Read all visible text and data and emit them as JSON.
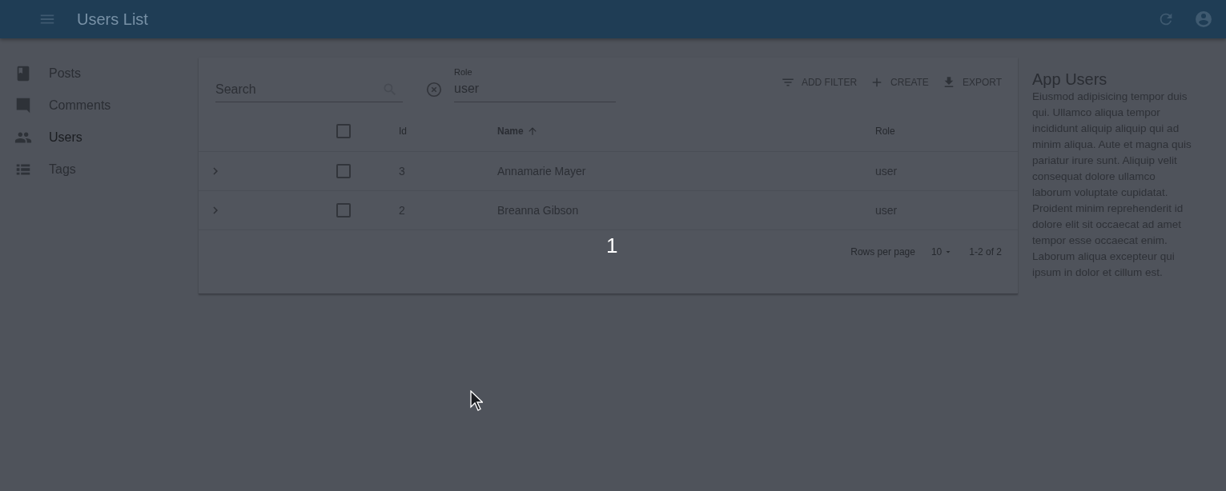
{
  "app_bar": {
    "title": "Users List"
  },
  "sidebar": {
    "items": [
      {
        "label": "Posts",
        "kind": "book",
        "selected": false
      },
      {
        "label": "Comments",
        "kind": "comment",
        "selected": false
      },
      {
        "label": "Users",
        "kind": "people",
        "selected": true
      },
      {
        "label": "Tags",
        "kind": "list",
        "selected": false
      }
    ]
  },
  "filters": {
    "search": {
      "placeholder": "Search"
    },
    "role": {
      "label": "Role",
      "value": "user"
    }
  },
  "actions": [
    {
      "label": "ADD FILTER",
      "kind": "filter"
    },
    {
      "label": "CREATE",
      "kind": "plus"
    },
    {
      "label": "EXPORT",
      "kind": "download"
    }
  ],
  "table": {
    "select_all": {
      "checked": false
    },
    "columns": [
      {
        "label": "Id",
        "sorted": false
      },
      {
        "label": "Name",
        "sorted": true
      },
      {
        "label": "Role",
        "sorted": false
      }
    ],
    "rows": [
      {
        "checked": false,
        "cells": [
          "3",
          "Annamarie Mayer",
          "user"
        ]
      },
      {
        "checked": false,
        "cells": [
          "2",
          "Breanna Gibson",
          "user"
        ]
      }
    ]
  },
  "pagination": {
    "rows_per_page_label": "Rows per page",
    "rows_per_page": "10",
    "range": "1-2 of 2"
  },
  "aside": {
    "title": "App Users",
    "body": "Eiusmod adipisicing tempor duis qui. Ullamco aliqua tempor incididunt aliquip aliquip qui ad minim aliqua. Aute et magna quis pariatur irure sunt. Aliquip velit consequat dolore ullamco laborum voluptate cupidatat. Proident minim reprehenderit id dolore elit sit occaecat ad amet tempor esse occaecat enim. Laborum aliqua excepteur qui ipsum in dolor et cillum est."
  },
  "overlay": {
    "countdown": "1"
  }
}
